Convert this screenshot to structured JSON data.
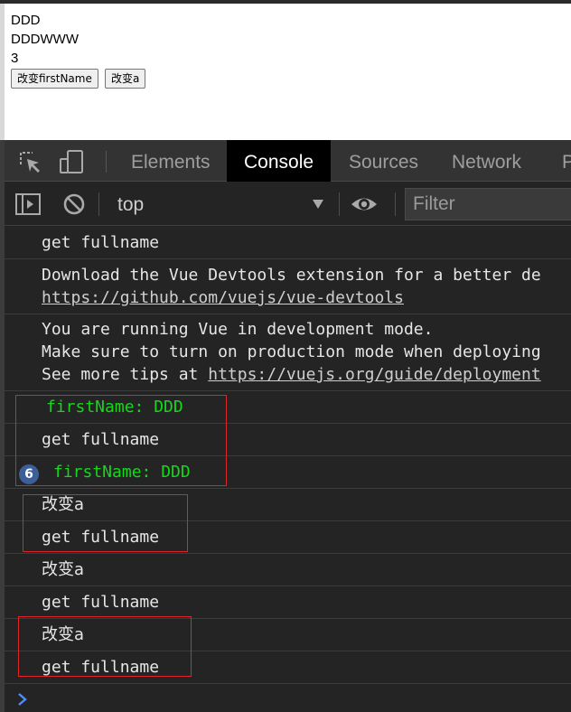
{
  "page": {
    "lines": [
      "DDD",
      "DDDWWW",
      "3"
    ],
    "buttons": [
      "改变firstName",
      "改变a"
    ]
  },
  "devtools": {
    "tabs": [
      "Elements",
      "Console",
      "Sources",
      "Network",
      "P"
    ],
    "active_tab": "Console",
    "toolbar": {
      "context": "top",
      "filter_placeholder": "Filter"
    },
    "messages": [
      {
        "lines": [
          "get fullname"
        ]
      },
      {
        "lines": [
          "Download the Vue Devtools extension for a better de",
          "https://github.com/vuejs/vue-devtools"
        ]
      },
      {
        "lines": [
          "You are running Vue in development mode.",
          "Make sure to turn on production mode when deploying",
          "See more tips at https://vuejs.org/guide/deployment"
        ]
      },
      {
        "lines": [
          " firstName: DDD"
        ]
      },
      {
        "lines": [
          "get fullname"
        ]
      },
      {
        "count": "6",
        "lines": [
          " firstName: DDD"
        ]
      },
      {
        "lines": [
          "改变a"
        ]
      },
      {
        "lines": [
          "get fullname"
        ]
      },
      {
        "lines": [
          "改变a"
        ]
      },
      {
        "lines": [
          "get fullname"
        ]
      },
      {
        "lines": [
          "改变a"
        ]
      },
      {
        "lines": [
          "get fullname"
        ]
      }
    ],
    "vue_tips_prefix": "See more tips at ",
    "vue_tips_link": "https://vuejs.org/guide/deployment"
  },
  "colors": {
    "log_green": "#16d71b",
    "highlight_red": "#e0242b",
    "badge_blue": "#3d5f99",
    "console_bg": "#242424"
  },
  "icons": [
    "inspect-element-icon",
    "device-toolbar-icon",
    "sidebar-toggle-icon",
    "clear-console-icon",
    "dropdown-arrow-icon",
    "eye-icon",
    "prompt-chevron-icon"
  ]
}
